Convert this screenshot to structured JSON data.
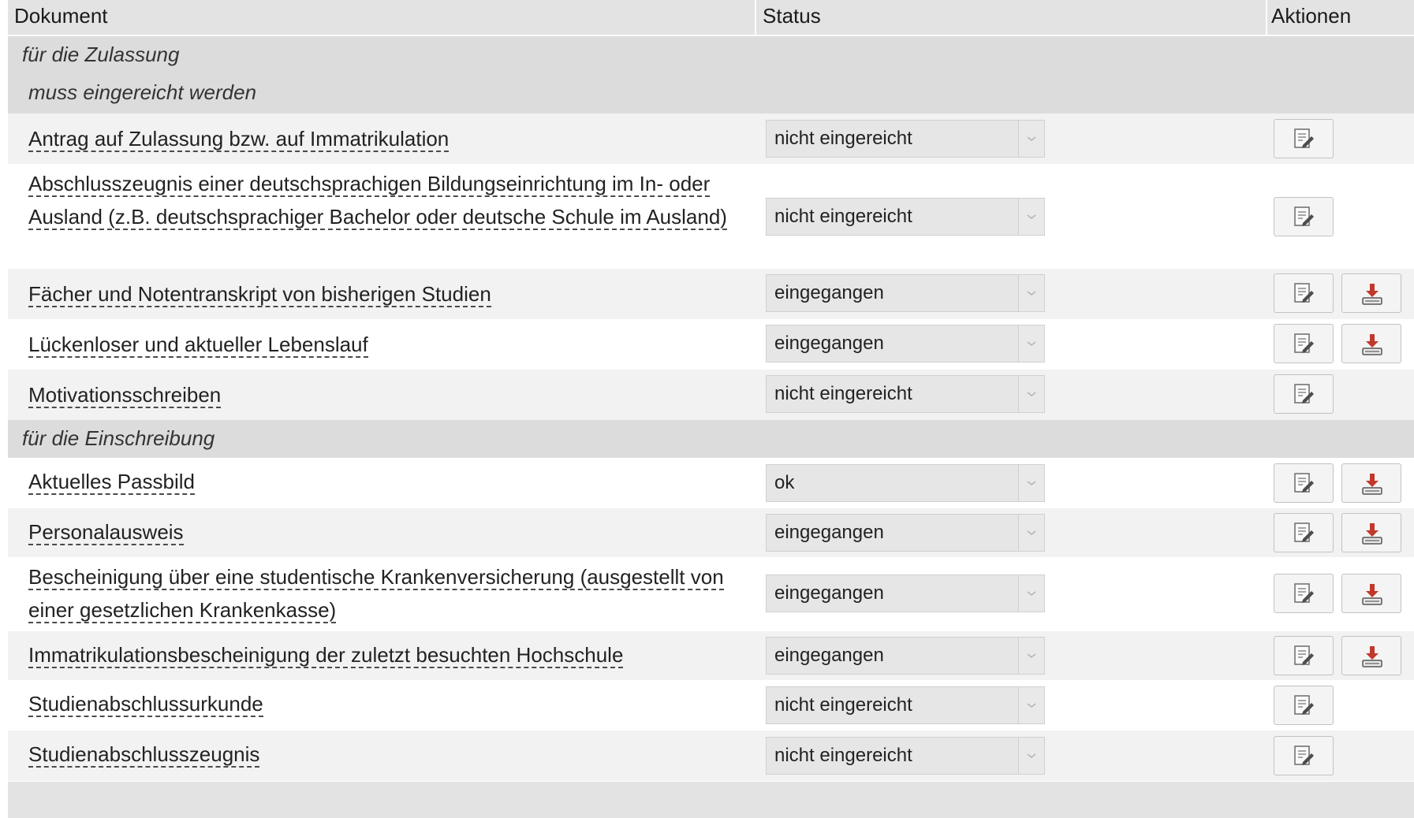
{
  "header": {
    "col_document": "Dokument",
    "col_status": "Status",
    "col_actions": "Aktionen"
  },
  "groups": {
    "zulassung": "für die Zulassung",
    "muss": "muss eingereicht werden",
    "einschreibung": "für die Einschreibung"
  },
  "rows": [
    {
      "label": "Antrag auf Zulassung bzw. auf Immatrikulation",
      "status": "nicht eingereicht"
    },
    {
      "label": "Abschlusszeugnis einer deutschsprachigen Bildungseinrichtung im In- oder Ausland (z.B. deutschsprachiger Bachelor oder deutsche Schule im Ausland)",
      "status": "nicht eingereicht"
    },
    {
      "label": "Fächer und Notentranskript von bisherigen Studien",
      "status": "eingegangen"
    },
    {
      "label": "Lückenloser und aktueller Lebenslauf",
      "status": "eingegangen"
    },
    {
      "label": "Motivationsschreiben",
      "status": "nicht eingereicht"
    },
    {
      "label": "Aktuelles Passbild",
      "status": "ok"
    },
    {
      "label": "Personalausweis",
      "status": "eingegangen"
    },
    {
      "label": "Bescheinigung über eine studentische Krankenversicherung (ausgestellt von einer gesetzlichen Krankenkasse)",
      "status": "eingegangen"
    },
    {
      "label": "Immatrikulationsbescheinigung der zuletzt besuchten Hochschule",
      "status": "eingegangen"
    },
    {
      "label": "Studienabschlussurkunde",
      "status": "nicht eingereicht"
    },
    {
      "label": "Studienabschlusszeugnis",
      "status": "nicht eingereicht"
    }
  ],
  "icons": {
    "edit": "edit-document-icon",
    "download": "download-icon",
    "select_arrow": "chevron-down-icon"
  },
  "colors": {
    "header_bg": "#e3e3e3",
    "group_bg": "#dcdcdc",
    "row_alt_bg": "#f2f2f2",
    "download_red": "#c0392b"
  }
}
